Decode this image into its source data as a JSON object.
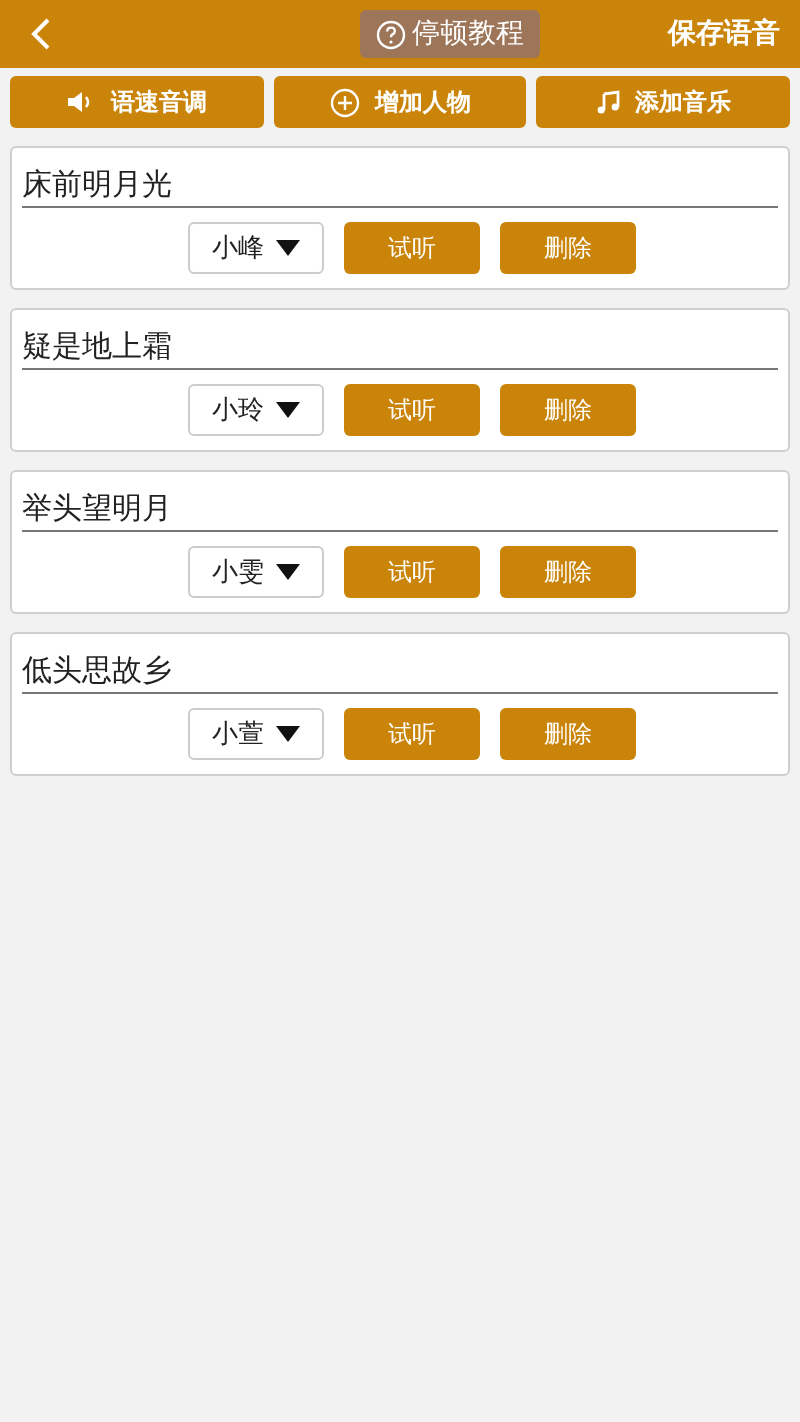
{
  "header": {
    "help_button": "停顿教程",
    "save_button": "保存语音"
  },
  "toolbar": [
    {
      "kind": "speaker",
      "label": "语速音调"
    },
    {
      "kind": "plus",
      "label": "增加人物"
    },
    {
      "kind": "music",
      "label": "添加音乐"
    }
  ],
  "lines": [
    {
      "text": "床前明月光",
      "voice": "小峰",
      "preview": "试听",
      "delete": "删除"
    },
    {
      "text": "疑是地上霜",
      "voice": "小玲",
      "preview": "试听",
      "delete": "删除"
    },
    {
      "text": "举头望明月",
      "voice": "小雯",
      "preview": "试听",
      "delete": "删除"
    },
    {
      "text": "低头思故乡",
      "voice": "小萱",
      "preview": "试听",
      "delete": "删除"
    }
  ]
}
